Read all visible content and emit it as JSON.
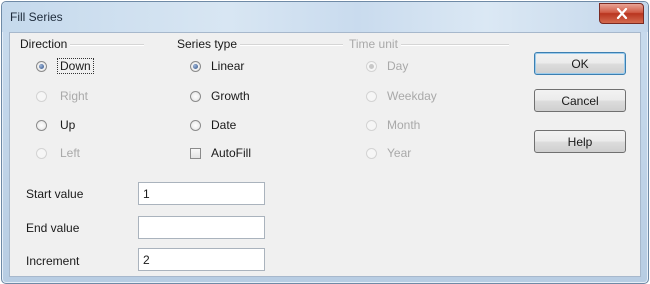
{
  "window": {
    "title": "Fill Series"
  },
  "direction": {
    "title": "Direction",
    "options": [
      {
        "label": "Down",
        "checked": true,
        "enabled": true
      },
      {
        "label": "Right",
        "checked": false,
        "enabled": false
      },
      {
        "label": "Up",
        "checked": false,
        "enabled": true
      },
      {
        "label": "Left",
        "checked": false,
        "enabled": false
      }
    ]
  },
  "series_type": {
    "title": "Series type",
    "options": [
      {
        "label": "Linear",
        "checked": true
      },
      {
        "label": "Growth",
        "checked": false
      },
      {
        "label": "Date",
        "checked": false
      },
      {
        "label": "AutoFill",
        "checked": false
      }
    ]
  },
  "time_unit": {
    "title": "Time unit",
    "enabled": false,
    "options": [
      {
        "label": "Day",
        "checked": true
      },
      {
        "label": "Weekday",
        "checked": false
      },
      {
        "label": "Month",
        "checked": false
      },
      {
        "label": "Year",
        "checked": false
      }
    ]
  },
  "buttons": {
    "ok": "OK",
    "cancel": "Cancel",
    "help": "Help"
  },
  "fields": {
    "start": {
      "label": "Start value",
      "value": "1"
    },
    "end": {
      "label": "End value",
      "value": ""
    },
    "increment": {
      "label": "Increment",
      "value": "2"
    }
  },
  "colors": {
    "title_bar": "#c9dcee",
    "close_button": "#c8412b",
    "dialog_background": "#f0f0f0",
    "default_button_border": "#3c7fb1"
  },
  "icons": {
    "close": "close-x-icon"
  }
}
